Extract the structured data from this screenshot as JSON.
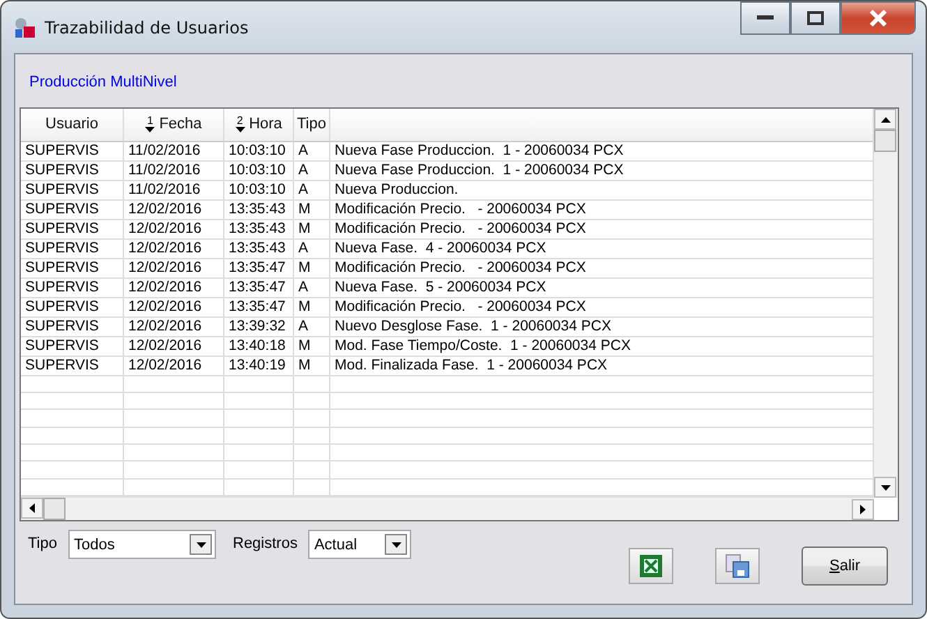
{
  "window": {
    "title": "Trazabilidad de Usuarios"
  },
  "subtitle": "Producción MultiNivel",
  "table": {
    "columns": [
      {
        "label": "Usuario"
      },
      {
        "label": "Fecha",
        "sort": "1"
      },
      {
        "label": "Hora",
        "sort": "2"
      },
      {
        "label": "Tipo"
      }
    ],
    "rows": [
      [
        "SUPERVIS",
        "11/02/2016",
        "10:03:10",
        "A",
        "Nueva Fase Produccion.  1 - 20060034 PCX"
      ],
      [
        "SUPERVIS",
        "11/02/2016",
        "10:03:10",
        "A",
        "Nueva Fase Produccion.  1 - 20060034 PCX"
      ],
      [
        "SUPERVIS",
        "11/02/2016",
        "10:03:10",
        "A",
        "Nueva Produccion."
      ],
      [
        "SUPERVIS",
        "12/02/2016",
        "13:35:43",
        "M",
        "Modificación Precio.   - 20060034 PCX"
      ],
      [
        "SUPERVIS",
        "12/02/2016",
        "13:35:43",
        "M",
        "Modificación Precio.   - 20060034 PCX"
      ],
      [
        "SUPERVIS",
        "12/02/2016",
        "13:35:43",
        "A",
        "Nueva Fase.  4 - 20060034 PCX"
      ],
      [
        "SUPERVIS",
        "12/02/2016",
        "13:35:47",
        "M",
        "Modificación Precio.   - 20060034 PCX"
      ],
      [
        "SUPERVIS",
        "12/02/2016",
        "13:35:47",
        "A",
        "Nueva Fase.  5 - 20060034 PCX"
      ],
      [
        "SUPERVIS",
        "12/02/2016",
        "13:35:47",
        "M",
        "Modificación Precio.   - 20060034 PCX"
      ],
      [
        "SUPERVIS",
        "12/02/2016",
        "13:39:32",
        "A",
        "Nuevo Desglose Fase.  1 - 20060034 PCX"
      ],
      [
        "SUPERVIS",
        "12/02/2016",
        "13:40:18",
        "M",
        "Mod. Fase Tiempo/Coste.  1 - 20060034 PCX"
      ],
      [
        "SUPERVIS",
        "12/02/2016",
        "13:40:19",
        "M",
        "Mod. Finalizada Fase.  1 - 20060034 PCX"
      ]
    ]
  },
  "filters": [
    {
      "label": "Tipo",
      "value": "Todos"
    },
    {
      "label": "Registros",
      "value": "Actual"
    }
  ],
  "exit_button": "Salir"
}
